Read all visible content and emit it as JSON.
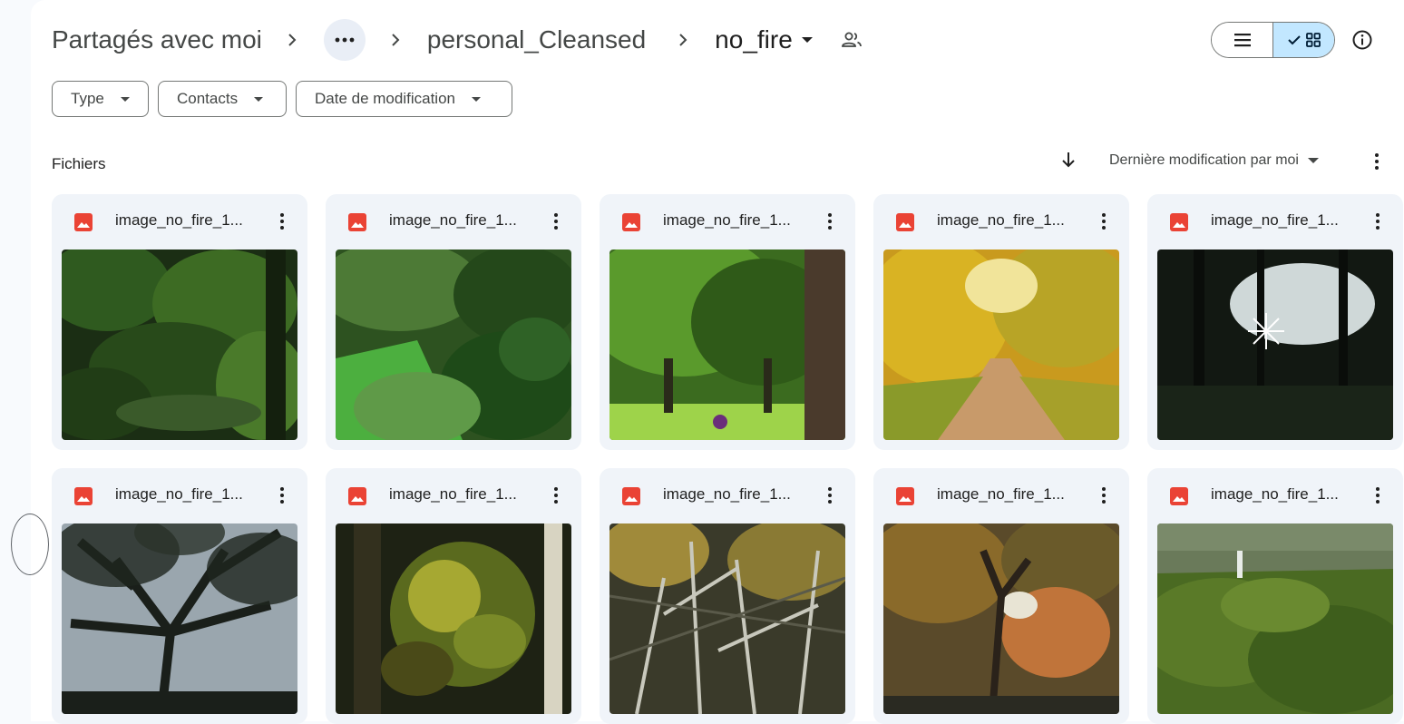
{
  "breadcrumb": {
    "root": "Partagés avec moi",
    "more_label": "•••",
    "folder": "personal_Cleansed",
    "current": "no_fire"
  },
  "filters": [
    {
      "label": "Type"
    },
    {
      "label": "Contacts"
    },
    {
      "label": "Date de modification"
    }
  ],
  "section": {
    "title": "Fichiers",
    "sort_label": "Dernière modification par moi"
  },
  "colors": {
    "accent": "#c2e7ff",
    "card_bg": "#f0f4f9",
    "image_icon": "#ea4335"
  },
  "files": [
    {
      "name": "image_no_fire_1...",
      "thumb": "dark-green-forest"
    },
    {
      "name": "image_no_fire_1...",
      "thumb": "green-garden-shrubs"
    },
    {
      "name": "image_no_fire_1...",
      "thumb": "park-trees-lawn"
    },
    {
      "name": "image_no_fire_1...",
      "thumb": "autumn-forest-path"
    },
    {
      "name": "image_no_fire_1...",
      "thumb": "dark-forest-sunburst"
    },
    {
      "name": "image_no_fire_1...",
      "thumb": "tree-silhouette-branches"
    },
    {
      "name": "image_no_fire_1...",
      "thumb": "autumn-leaves-closeup"
    },
    {
      "name": "image_no_fire_1...",
      "thumb": "bare-trees-autumn"
    },
    {
      "name": "image_no_fire_1...",
      "thumb": "autumn-park-alley"
    },
    {
      "name": "image_no_fire_1...",
      "thumb": "forest-canopy-aerial"
    }
  ]
}
